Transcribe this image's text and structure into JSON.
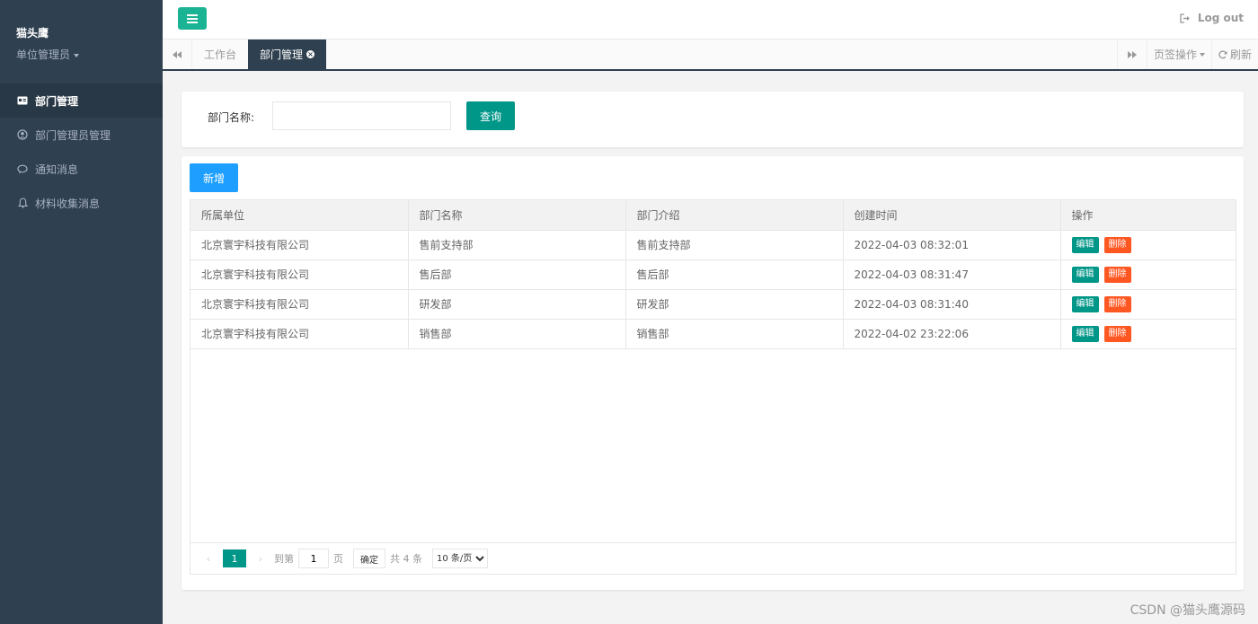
{
  "sidebar": {
    "user_name": "猫头鹰",
    "user_role": "单位管理员",
    "items": [
      {
        "label": "部门管理",
        "icon": "id-card-icon",
        "active": true
      },
      {
        "label": "部门管理员管理",
        "icon": "user-circle-icon",
        "active": false
      },
      {
        "label": "通知消息",
        "icon": "comment-icon",
        "active": false
      },
      {
        "label": "材料收集消息",
        "icon": "bell-icon",
        "active": false
      }
    ]
  },
  "topbar": {
    "logout_label": "Log out"
  },
  "tabs": {
    "items": [
      {
        "label": "工作台",
        "active": false
      },
      {
        "label": "部门管理",
        "active": true
      }
    ],
    "tab_ops_label": "页签操作",
    "refresh_label": "刷新"
  },
  "search": {
    "label": "部门名称:",
    "value": "",
    "button_label": "查询"
  },
  "table": {
    "add_label": "新增",
    "columns": [
      "所属单位",
      "部门名称",
      "部门介绍",
      "创建时间",
      "操作"
    ],
    "rows": [
      {
        "unit": "北京寰宇科技有限公司",
        "name": "售前支持部",
        "intro": "售前支持部",
        "created": "2022-04-03 08:32:01"
      },
      {
        "unit": "北京寰宇科技有限公司",
        "name": "售后部",
        "intro": "售后部",
        "created": "2022-04-03 08:31:47"
      },
      {
        "unit": "北京寰宇科技有限公司",
        "name": "研发部",
        "intro": "研发部",
        "created": "2022-04-03 08:31:40"
      },
      {
        "unit": "北京寰宇科技有限公司",
        "name": "销售部",
        "intro": "销售部",
        "created": "2022-04-02 23:22:06"
      }
    ],
    "edit_label": "编辑",
    "delete_label": "删除"
  },
  "pager": {
    "current_page": "1",
    "goto_label": "到第",
    "goto_value": "1",
    "page_unit": "页",
    "confirm_label": "确定",
    "total_label": "共 4 条",
    "limit_label": "10 条/页"
  },
  "watermark": "CSDN @猫头鹰源码",
  "colors": {
    "sidebar_bg": "#2f4050",
    "primary_green": "#009688",
    "menu_green": "#1ab394",
    "add_blue": "#1e9fff",
    "delete_orange": "#ff5722"
  }
}
